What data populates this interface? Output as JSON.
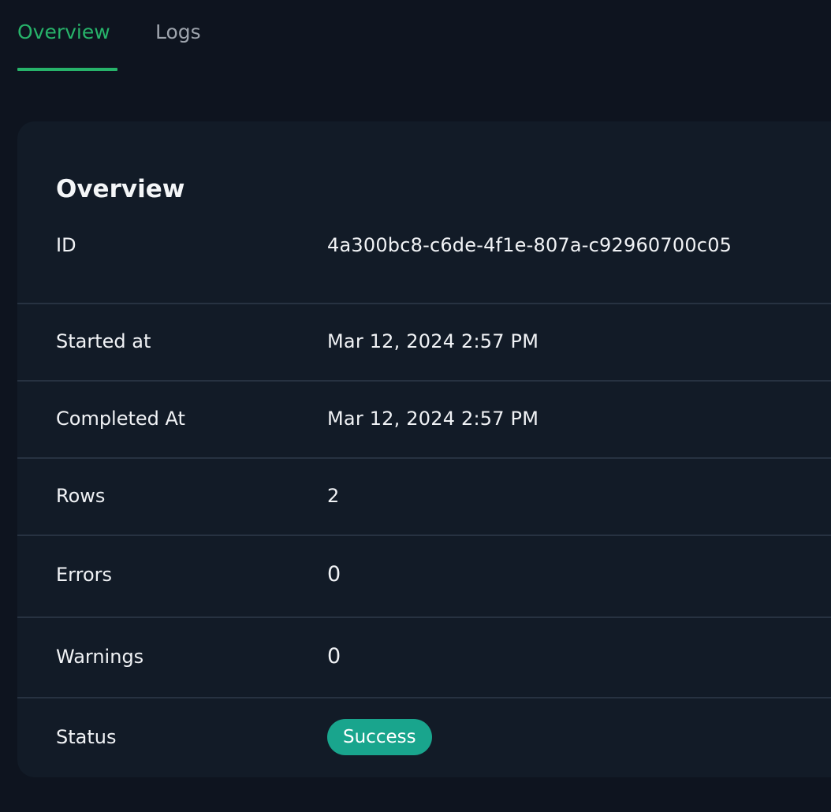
{
  "tabs": [
    {
      "label": "Overview",
      "active": true
    },
    {
      "label": "Logs",
      "active": false
    }
  ],
  "overview": {
    "title": "Overview",
    "rows": [
      {
        "label": "ID",
        "value": "4a300bc8-c6de-4f1e-807a-c92960700c05"
      },
      {
        "label": "Started at",
        "value": "Mar 12, 2024 2:57 PM"
      },
      {
        "label": "Completed At",
        "value": "Mar 12, 2024 2:57 PM"
      },
      {
        "label": "Rows",
        "value": "2"
      },
      {
        "label": "Errors",
        "value": "0"
      },
      {
        "label": "Warnings",
        "value": "0"
      },
      {
        "label": "Status",
        "value": "Success"
      }
    ]
  },
  "colors": {
    "background": "#0e141f",
    "card": "#121b27",
    "accent": "#27b36a",
    "success_badge": "#19a58d",
    "divider": "#273241"
  }
}
